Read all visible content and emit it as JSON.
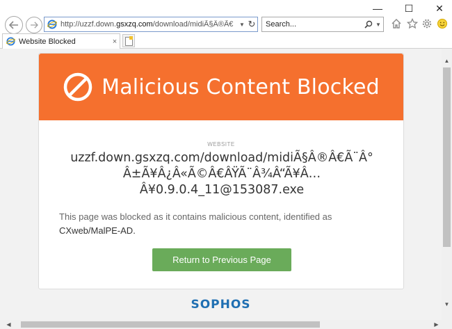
{
  "window": {
    "minimize": "—",
    "maximize": "☐",
    "close": "✕"
  },
  "addressbar": {
    "url_prefix": "http://uzzf.down.",
    "url_domain": "gsxzq.com",
    "url_rest": "/download/midiÃ§Â®Ã€",
    "refresh": "↻"
  },
  "search": {
    "placeholder": "Search...",
    "mag": "⚲"
  },
  "tab": {
    "label": "Website Blocked",
    "close": "×"
  },
  "page": {
    "title": "Malicious Content Blocked",
    "website_label": "WEBSITE",
    "website_url_line1": "uzzf.down.gsxzq.com/download/midiÃ§Â®Â€Ã¨Â°",
    "website_url_line2": "Â±Ã¥Â¿Â«Ã©Â€ÂŸÃ¨Â¾Â“Ã¥Â…",
    "website_url_line3": "Â¥0.9.0.4_11@153087.exe",
    "message_prefix": "This page was blocked as it contains malicious content, identified as",
    "threat_name": "CXweb/MalPE-AD.",
    "return_button": "Return to Previous Page",
    "brand": "SOPHOS"
  },
  "colors": {
    "banner": "#f5702e",
    "button": "#6aab5a",
    "brand": "#1f6fb2"
  },
  "icons": {
    "back": "arrow-left-icon",
    "forward": "arrow-right-icon",
    "home": "home-icon",
    "favorites": "star-icon",
    "tools": "gear-icon",
    "feedback": "smiley-icon",
    "blocked": "prohibited-icon"
  }
}
